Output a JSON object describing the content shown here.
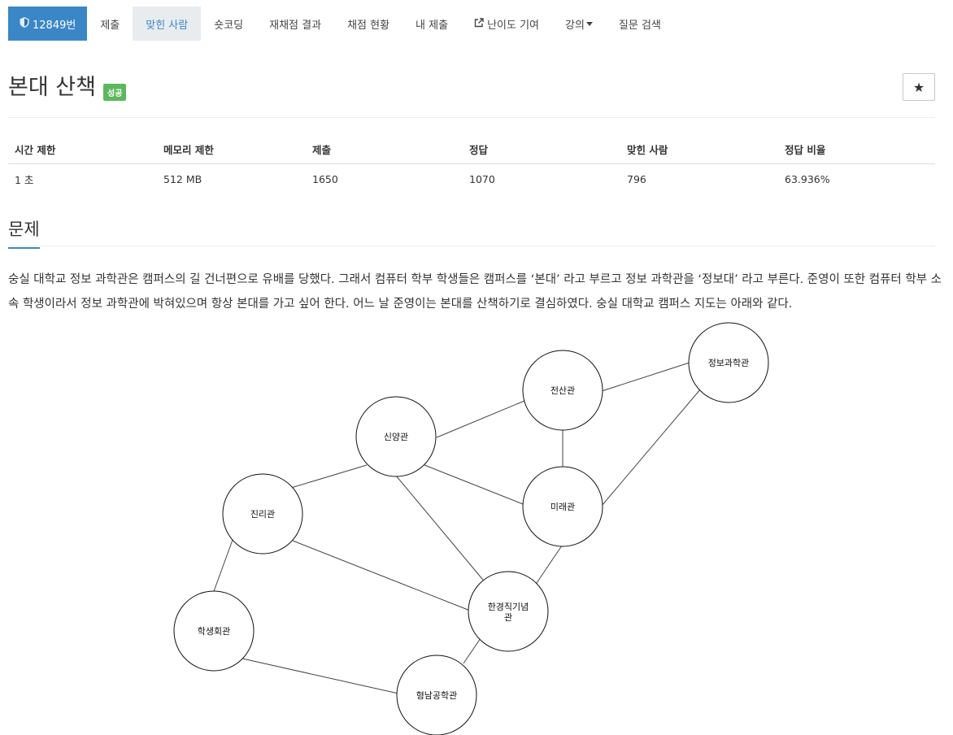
{
  "nav": {
    "problem_number": "12849번",
    "items": [
      "제출",
      "맞힌 사람",
      "숏코딩",
      "재채점 결과",
      "채점 현황",
      "내 제출",
      "난이도 기여",
      "강의",
      "질문 검색"
    ]
  },
  "title": "본대 산책",
  "badge": "성공",
  "star": "★",
  "stats": {
    "headers": [
      "시간 제한",
      "메모리 제한",
      "제출",
      "정답",
      "맞힌 사람",
      "정답 비율"
    ],
    "values": [
      "1 초",
      "512 MB",
      "1650",
      "1070",
      "796",
      "63.936%"
    ]
  },
  "section_title": "문제",
  "description": "숭실 대학교 정보 과학관은  캠퍼스의 길 건너편으로 유배를 당했다. 그래서 컴퓨터 학부 학생들은 캠퍼스를 ‘본대’ 라고 부르고 정보 과학관을 ‘정보대’ 라고 부른다. 준영이 또한 컴퓨터 학부 소속 학생이라서 정보 과학관에 박혀있으며 항상 본대를 가고 싶어 한다. 어느 날 준영이는 본대를 산책하기로 결심하였다. 숭실 대학교 캠퍼스 지도는 아래와 같다.",
  "graph": {
    "nodes": {
      "jeongbo": "정보과학관",
      "jeonsan": "전산관",
      "sinyang": "신양관",
      "mirae": "미래관",
      "jinri": "진리관",
      "hangyeong_1": "한경직기념",
      "hangyeong_2": "관",
      "haksaeng": "학생회관",
      "hyeongnam": "형남공학관"
    }
  }
}
